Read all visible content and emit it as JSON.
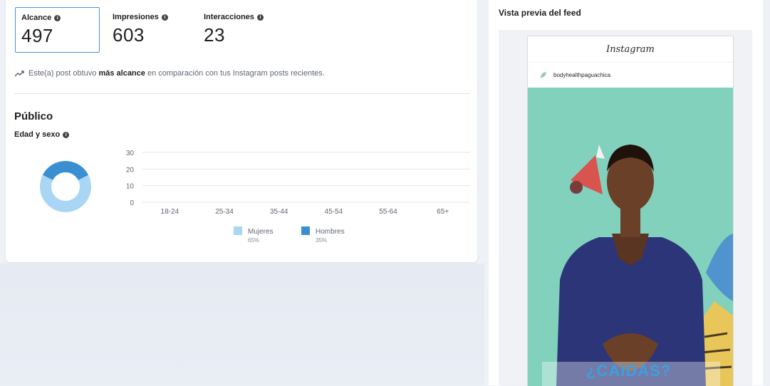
{
  "metrics": [
    {
      "label": "Alcance",
      "value": "497",
      "selected": true
    },
    {
      "label": "Impresiones",
      "value": "603",
      "selected": false
    },
    {
      "label": "Interacciones",
      "value": "23",
      "selected": false
    }
  ],
  "insight": {
    "prefix": "Este(a) post obtuvo ",
    "bold": "más alcance",
    "suffix": " en comparación con tus Instagram posts recientes."
  },
  "audience": {
    "title": "Público",
    "subtitle": "Edad y sexo"
  },
  "chart_data": {
    "type": "bar",
    "categories": [
      "18-24",
      "25-34",
      "35-44",
      "45-54",
      "55-64",
      "65+"
    ],
    "series": [
      {
        "name": "Mujeres",
        "values": [
          0,
          0,
          0,
          0,
          0,
          0
        ]
      },
      {
        "name": "Hombres",
        "values": [
          0,
          0,
          0,
          0,
          0,
          0
        ]
      }
    ],
    "yticks": [
      "30",
      "20",
      "10",
      "0"
    ],
    "ylim": [
      0,
      30
    ],
    "legend": [
      {
        "name": "Mujeres",
        "pct": "65%",
        "color": "#a9d6f5"
      },
      {
        "name": "Hombres",
        "pct": "35%",
        "color": "#3a8fd0"
      }
    ],
    "donut": {
      "values": [
        65,
        35
      ],
      "colors": [
        "#a9d6f5",
        "#3a8fd0"
      ]
    },
    "grid": true,
    "legend_position": "bottom"
  },
  "feed": {
    "title": "Vista previa del feed",
    "app_name": "Instagram",
    "username": "bodyhealthpaguachica",
    "caption_overlay": "¿CAIDAS?"
  },
  "colors": {
    "accent": "#4a90d9",
    "mujeres": "#a9d6f5",
    "hombres": "#3a8fd0",
    "media_bg": "#7ccfb9",
    "shirt": "#2c3578"
  }
}
